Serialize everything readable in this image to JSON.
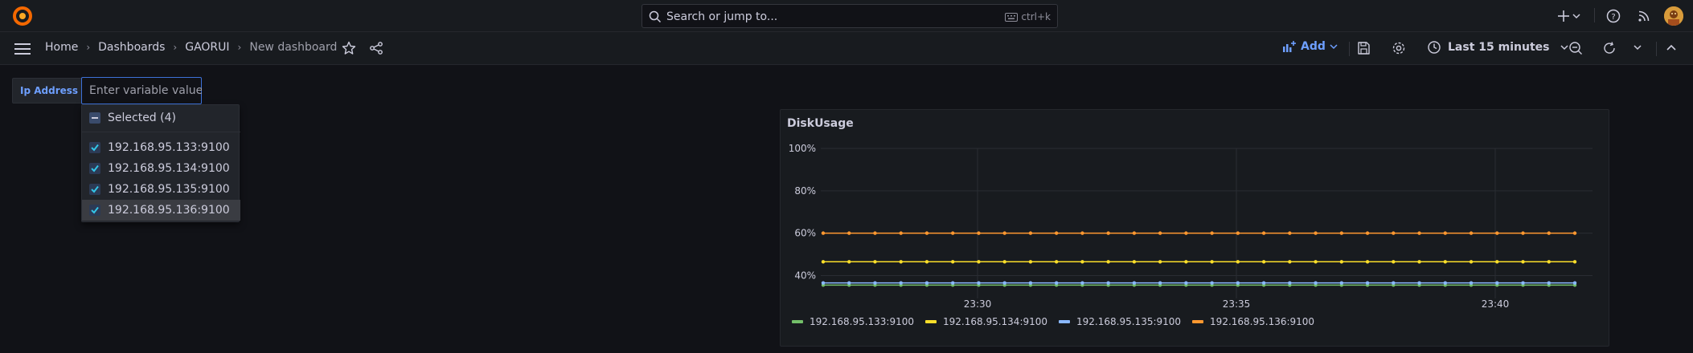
{
  "topbar": {
    "search_placeholder": "Search or jump to...",
    "search_shortcut": "ctrl+k",
    "icons": [
      "grafana-logo-icon",
      "search-icon",
      "keyboard-icon",
      "plus-icon",
      "chevron-down-icon",
      "help-icon",
      "news-icon",
      "avatar"
    ]
  },
  "breadcrumbs": [
    "Home",
    "Dashboards",
    "GAORUI",
    "New dashboard"
  ],
  "toolbar": {
    "add_label": "Add",
    "time_range": "Last 15 minutes",
    "icons": [
      "star-icon",
      "share-icon",
      "add-panel-icon",
      "save-icon",
      "settings-icon",
      "clock-icon",
      "zoom-out-icon",
      "refresh-icon",
      "collapse-icon"
    ]
  },
  "variable": {
    "label": "Ip Address",
    "placeholder": "Enter variable value",
    "selected_label": "Selected (4)",
    "options": [
      {
        "value": "192.168.95.133:9100",
        "checked": true
      },
      {
        "value": "192.168.95.134:9100",
        "checked": true
      },
      {
        "value": "192.168.95.135:9100",
        "checked": true
      },
      {
        "value": "192.168.95.136:9100",
        "checked": true
      }
    ]
  },
  "panel": {
    "title": "DiskUsage"
  },
  "chart_data": {
    "type": "line",
    "title": "DiskUsage",
    "xlabel": "",
    "ylabel": "",
    "x_ticks": [
      "23:30",
      "23:35",
      "23:40"
    ],
    "y_ticks": [
      "100%",
      "80%",
      "60%",
      "40%"
    ],
    "ylim": [
      36,
      100
    ],
    "grid": true,
    "legend_position": "bottom",
    "points_per_series": 30,
    "series": [
      {
        "name": "192.168.95.133:9100",
        "color": "#73bf69",
        "value": 35.5
      },
      {
        "name": "192.168.95.134:9100",
        "color": "#fade2a",
        "value": 46.5
      },
      {
        "name": "192.168.95.135:9100",
        "color": "#8ab8ff",
        "value": 36.5
      },
      {
        "name": "192.168.95.136:9100",
        "color": "#ff9830",
        "value": 60
      }
    ]
  }
}
